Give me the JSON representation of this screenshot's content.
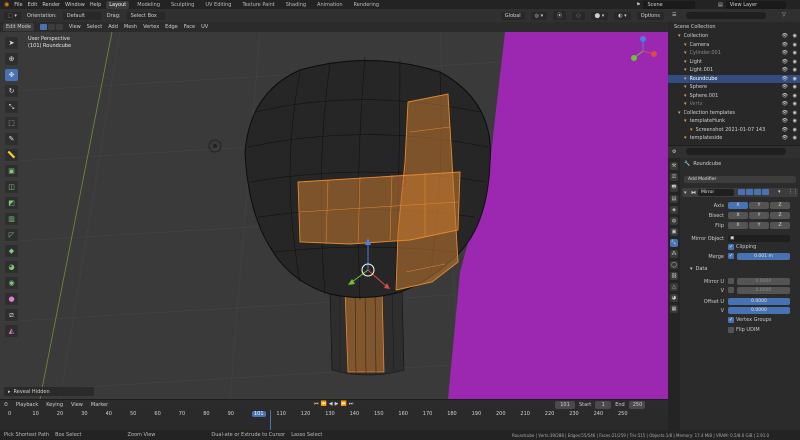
{
  "topbar": {
    "menus": [
      "File",
      "Edit",
      "Render",
      "Window",
      "Help"
    ],
    "workspaces": [
      "Layout",
      "Modeling",
      "Sculpting",
      "UV Editing",
      "Texture Paint",
      "Shading",
      "Animation",
      "Rendering"
    ],
    "active_workspace": "Layout",
    "scene": "Scene",
    "view_layer": "View Layer"
  },
  "tool_header": {
    "orientation": "Orientation:",
    "orientation_value": "Default",
    "drag": "Drag:",
    "drag_value": "Select Box",
    "transform": "Global",
    "options": "Options"
  },
  "viewport_header": {
    "mode": "Edit Mode",
    "menus": [
      "View",
      "Select",
      "Add",
      "Mesh",
      "Vertex",
      "Edge",
      "Face",
      "UV"
    ]
  },
  "viewport": {
    "view_name": "User Perspective",
    "object_name": "(101) Roundcube",
    "last_operator": "Reveal Hidden"
  },
  "timeline": {
    "menus": [
      "Playback",
      "Keying",
      "View",
      "Marker"
    ],
    "current_frame": "101",
    "start_label": "Start",
    "start": "1",
    "end_label": "End",
    "end": "250",
    "ruler": [
      "0",
      "10",
      "20",
      "30",
      "40",
      "50",
      "60",
      "70",
      "80",
      "90",
      "101",
      "110",
      "120",
      "130",
      "140",
      "150",
      "160",
      "170",
      "180",
      "190",
      "200",
      "210",
      "220",
      "230",
      "240",
      "250"
    ]
  },
  "statusbar": {
    "items": [
      "Pick Shortest Path",
      "Box Select",
      "Zoom View",
      "Dual-ate or Extrude to Cursor",
      "Lasso Select"
    ],
    "stats": "Roundcube | Verts:39/288 | Edges:55/546 | Faces:21/259 | Tris:515 | Objects:1/8 | Memory: 17.4 MiB | VRAM: 0.5/8.0 GiB | 2.91.0"
  },
  "outliner": {
    "title": "Scene Collection",
    "rows": [
      {
        "label": "Collection",
        "indent": 1,
        "color": "#d0d0d0"
      },
      {
        "label": "Camera",
        "indent": 2,
        "color": "#d0d0d0"
      },
      {
        "label": "Cylinder.001",
        "indent": 2,
        "color": "#8a8a8a"
      },
      {
        "label": "Light",
        "indent": 2,
        "color": "#d0d0d0"
      },
      {
        "label": "Light.001",
        "indent": 2,
        "color": "#d0d0d0"
      },
      {
        "label": "Roundcube",
        "indent": 2,
        "color": "#ffffff",
        "selected": true
      },
      {
        "label": "Sphere",
        "indent": 2,
        "color": "#d0d0d0"
      },
      {
        "label": "Sphere.001",
        "indent": 2,
        "color": "#d0d0d0"
      },
      {
        "label": "Vertx",
        "indent": 2,
        "color": "#7a7a7a"
      },
      {
        "label": "Collection templates",
        "indent": 1,
        "color": "#d0d0d0"
      },
      {
        "label": "templateHunk",
        "indent": 2,
        "color": "#d0d0d0"
      },
      {
        "label": "Screenshot 2021-01-07 143",
        "indent": 3,
        "color": "#d0d0d0"
      },
      {
        "label": "templateside",
        "indent": 2,
        "color": "#d0d0d0"
      }
    ]
  },
  "properties": {
    "object": "Roundcube",
    "add_modifier": "Add Modifier",
    "modifier_name": "Mirror",
    "axis_label": "Axis",
    "bisect_label": "Bisect",
    "flip_label": "Flip",
    "axes": [
      "X",
      "Y",
      "Z"
    ],
    "mirror_object": "Mirror Object",
    "clipping": "Clipping",
    "merge": "Merge",
    "merge_value": "0.001 m",
    "data": "Data",
    "mirror_u": "Mirror U",
    "v": "V",
    "offset_u": "Offset U",
    "offset_value": "0.0000",
    "zero": "0.0000",
    "vertex_groups": "Vertex Groups",
    "flip_udim": "Flip UDIM"
  },
  "colors": {
    "accent": "#4772b3",
    "selection_orange": "#e68a2e",
    "magenta_plane": "#9c27b0"
  }
}
